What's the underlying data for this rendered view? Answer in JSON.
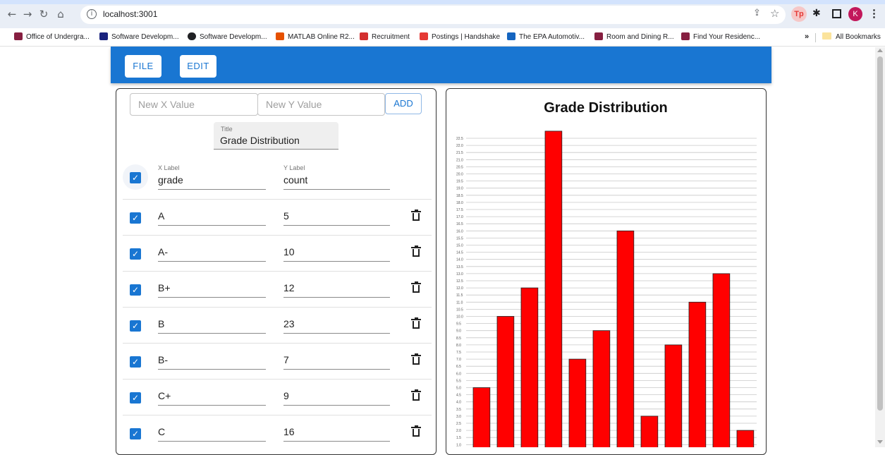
{
  "browser": {
    "url": "localhost:3001",
    "bookmarks": [
      {
        "label": "Office of Undergra...",
        "icon": "vt-icon",
        "color": "#861f41"
      },
      {
        "label": "Software Developm...",
        "icon": "car-icon",
        "color": "#1a237e"
      },
      {
        "label": "Software Developm...",
        "icon": "globe-icon",
        "color": "#202124"
      },
      {
        "label": "MATLAB Online R2...",
        "icon": "matlab-icon",
        "color": "#e65100"
      },
      {
        "label": "Recruitment",
        "icon": "recruit-icon",
        "color": "#d32f2f"
      },
      {
        "label": "Postings | Handshake",
        "icon": "handshake-icon",
        "color": "#e53935"
      },
      {
        "label": "The EPA Automotiv...",
        "icon": "epa-icon",
        "color": "#1565c0"
      },
      {
        "label": "Room and Dining R...",
        "icon": "vt-icon",
        "color": "#861f41"
      },
      {
        "label": "Find Your Residenc...",
        "icon": "vt-icon",
        "color": "#861f41"
      }
    ],
    "more_label": "»",
    "all_bookmarks": "All Bookmarks",
    "avatar_letter": "K",
    "ext_tp": "Tp"
  },
  "appbar": {
    "file_label": "FILE",
    "edit_label": "EDIT"
  },
  "editor": {
    "new_x_placeholder": "New X Value",
    "new_y_placeholder": "New Y Value",
    "add_label": "ADD",
    "title_label": "Title",
    "title_value": "Grade Distribution",
    "x_label_caption": "X Label",
    "x_label_value": "grade",
    "y_label_caption": "Y Label",
    "y_label_value": "count",
    "rows": [
      {
        "x": "A",
        "y": "5"
      },
      {
        "x": "A-",
        "y": "10"
      },
      {
        "x": "B+",
        "y": "12"
      },
      {
        "x": "B",
        "y": "23"
      },
      {
        "x": "B-",
        "y": "7"
      },
      {
        "x": "C+",
        "y": "9"
      },
      {
        "x": "C",
        "y": "16"
      }
    ]
  },
  "chart_data": {
    "type": "bar",
    "title": "Grade Distribution",
    "values": [
      5,
      10,
      12,
      23,
      7,
      9,
      16,
      3,
      8,
      11,
      13,
      2
    ],
    "bar_color": "#ff0000",
    "grid": true,
    "ylim": [
      1.0,
      22.5
    ],
    "ytick_step": 0.5
  }
}
